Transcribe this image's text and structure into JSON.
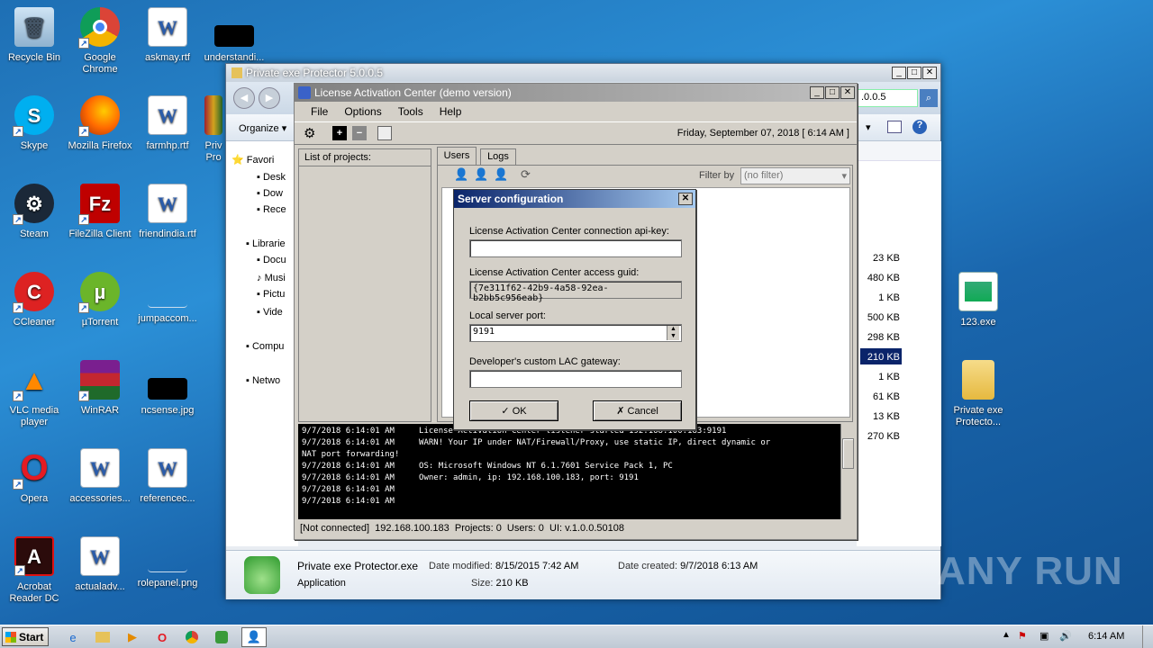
{
  "desktop_icons": {
    "recycle": "Recycle Bin",
    "chrome": "Google Chrome",
    "askmay": "askmay.rtf",
    "understand": "understandi...",
    "skype": "Skype",
    "firefox": "Mozilla Firefox",
    "farmhp": "farmhp.rtf",
    "priv": "Priv Pro",
    "steam": "Steam",
    "filezilla": "FileZilla Client",
    "friendindia": "friendindia.rtf",
    "ccleaner": "CCleaner",
    "utorrent": "µTorrent",
    "jumpaccom": "jumpaccom...",
    "vlc": "VLC media player",
    "winrar": "WinRAR",
    "ncsense": "ncsense.jpg",
    "opera": "Opera",
    "accessories": "accessories...",
    "referencec": "referencec...",
    "acrobat": "Acrobat Reader DC",
    "actualadv": "actualadv...",
    "rolepanel": "rolepanel.png",
    "exe123": "123.exe",
    "pep_folder": "Private exe Protecto..."
  },
  "explorer": {
    "title": "Private exe Protector 5.0.0.5",
    "address_fragment": ".0.0.5",
    "organize": "Organize",
    "nav": [
      "Favori",
      "Desk",
      "Dow",
      "Rece",
      "Librarie",
      "Docu",
      "Musi",
      "Pictu",
      "Vide",
      "Compu",
      "Netwo"
    ],
    "sizes": [
      "23 KB",
      "480 KB",
      "1 KB",
      "500 KB",
      "298 KB",
      "210 KB",
      "1 KB",
      "61 KB",
      "13 KB",
      "270 KB"
    ],
    "details": {
      "filename": "Private exe Protector.exe",
      "type": "Application",
      "modified_label": "Date modified:",
      "modified": "8/15/2015 7:42 AM",
      "created_label": "Date created:",
      "created": "9/7/2018 6:13 AM",
      "size_label": "Size:",
      "size": "210 KB"
    }
  },
  "lac": {
    "title": "License Activation Center (demo version)",
    "menu": [
      "File",
      "Options",
      "Tools",
      "Help"
    ],
    "date": "Friday, September 07, 2018",
    "time": "[ 6:14 AM ]",
    "projects_header": "List of projects:",
    "tabs": [
      "Users",
      "Logs"
    ],
    "filter_label": "Filter by",
    "filter_value": "(no filter)",
    "log": [
      "9/7/2018 6:14:01 AM     License Activation Center listener started 192.168.100.183:9191",
      "9/7/2018 6:14:01 AM     WARN! Your IP under NAT/Firewall/Proxy, use static IP, direct dynamic or",
      "NAT port forwarding!",
      "9/7/2018 6:14:01 AM     OS: Microsoft Windows NT 6.1.7601 Service Pack 1, PC",
      "9/7/2018 6:14:01 AM     Owner: admin, ip: 192.168.100.183, port: 9191",
      "9/7/2018 6:14:01 AM",
      "9/7/2018 6:14:01 AM"
    ],
    "status": "[Not connected]  192.168.100.183  Projects: 0  Users: 0  UI: v.1.0.0.50108"
  },
  "dialog": {
    "title": "Server configuration",
    "api_key_label": "License Activation Center connection api-key:",
    "api_key_value": "",
    "guid_label": "License Activation Center access guid:",
    "guid_value": "{7e311f62-42b9-4a58-92ea-b2bb5c956eab}",
    "port_label": "Local server port:",
    "port_value": "9191",
    "gateway_label": "Developer's custom LAC gateway:",
    "gateway_value": "",
    "ok": "OK",
    "cancel": "Cancel"
  },
  "taskbar": {
    "start": "Start",
    "clock": "6:14 AM"
  },
  "watermark": "ANY RUN"
}
